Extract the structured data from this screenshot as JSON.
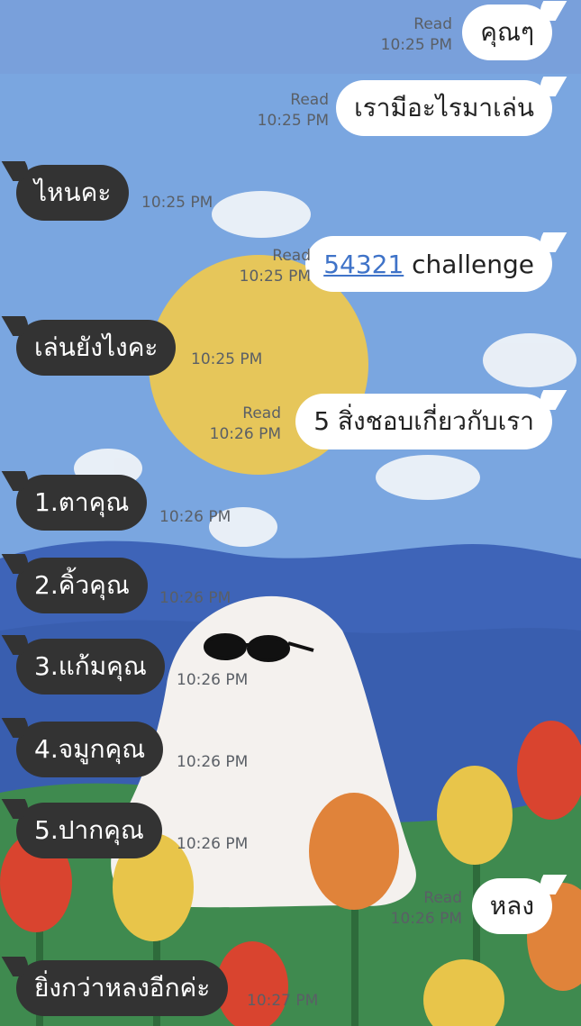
{
  "messages": [
    {
      "side": "me",
      "text": "คุณๆ",
      "read": "Read",
      "time": "10:25 PM"
    },
    {
      "side": "me",
      "text": "เรามีอะไรมาเล่น",
      "read": "Read",
      "time": "10:25 PM"
    },
    {
      "side": "them",
      "text": "ไหนคะ",
      "time": "10:25 PM"
    },
    {
      "side": "me",
      "link_text": "54321",
      "text_rest": " challenge",
      "read": "Read",
      "time": "10:25 PM"
    },
    {
      "side": "them",
      "text": "เล่นยังไงคะ",
      "time": "10:25 PM"
    },
    {
      "side": "me",
      "text": "5 สิ่งชอบเกี่ยวกับเรา",
      "read": "Read",
      "time": "10:26 PM"
    },
    {
      "side": "them",
      "text": "1.ตาคุณ",
      "time": "10:26 PM"
    },
    {
      "side": "them",
      "text": "2.คิ้วคุณ",
      "time": "10:26 PM"
    },
    {
      "side": "them",
      "text": "3.แก้มคุณ",
      "time": "10:26 PM"
    },
    {
      "side": "them",
      "text": "4.จมูกคุณ",
      "time": "10:26 PM"
    },
    {
      "side": "them",
      "text": "5.ปากคุณ",
      "time": "10:26 PM"
    },
    {
      "side": "me",
      "text": "หลง",
      "read": "Read",
      "time": "10:26 PM"
    },
    {
      "side": "them",
      "text": "ยิ่งกว่าหลงอีกค่ะ",
      "time": "10:27 PM"
    }
  ],
  "wallpaper": {
    "sky": "#7aa6e0",
    "sun": "#e6c65a",
    "mountain": "#3e64b8",
    "grass": "#3f8a4f",
    "ghost": "#f4f1ee",
    "tulip_red": "#d9442f",
    "tulip_yellow": "#e8c54a",
    "tulip_orange": "#e0833a"
  },
  "colors": {
    "bubble_me": "#ffffff",
    "bubble_them": "#333333",
    "link": "#3f73c8",
    "meta": "#5a5f66"
  }
}
